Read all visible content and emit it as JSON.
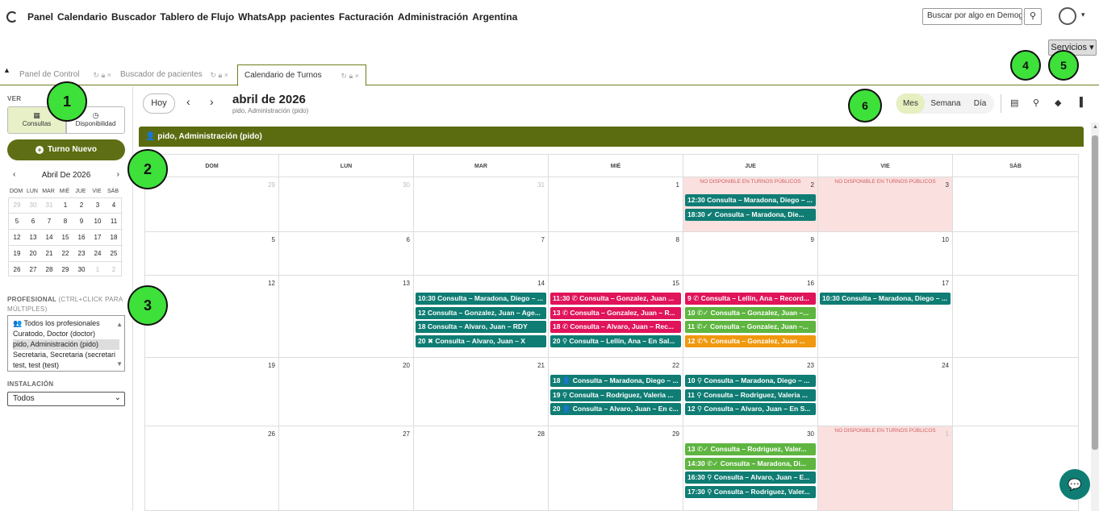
{
  "topnav": {
    "menu": [
      "Panel",
      "Calendario",
      "Buscador",
      "Tablero de Flujo",
      "WhatsApp",
      "pacientes",
      "Facturación",
      "Administración",
      "Argentina"
    ],
    "search_placeholder": "Buscar por algo en Demogra",
    "servicios_label": "Servicios"
  },
  "tabs": [
    {
      "label": "Panel de Control",
      "active": false
    },
    {
      "label": "Buscador de pacientes",
      "active": false
    },
    {
      "label": "Calendario de Turnos",
      "active": true
    }
  ],
  "sidebar": {
    "ver_label": "VER",
    "consultas_label": "Consultas",
    "disponibilidad_label": "Disponibilidad",
    "turno_nuevo_label": "Turno Nuevo",
    "minical": {
      "title": "Abril De 2026",
      "weekdays": [
        "DOM",
        "LUN",
        "MAR",
        "MIÉ",
        "JUE",
        "VIE",
        "SÁB"
      ],
      "weeks": [
        [
          "29",
          "30",
          "31",
          "1",
          "2",
          "3",
          "4"
        ],
        [
          "5",
          "6",
          "7",
          "8",
          "9",
          "10",
          "11"
        ],
        [
          "12",
          "13",
          "14",
          "15",
          "16",
          "17",
          "18"
        ],
        [
          "19",
          "20",
          "21",
          "22",
          "23",
          "24",
          "25"
        ],
        [
          "26",
          "27",
          "28",
          "29",
          "30",
          "1",
          "2"
        ]
      ]
    },
    "profesional_label": "PROFESIONAL",
    "profesional_hint": "(CTRL+CLICK PARA MÚLTIPLES)",
    "profesionales": [
      "Todos los profesionales",
      "Curatodo, Doctor (doctor)",
      "pido, Administración (pido)",
      "Secretaria, Secretaria (secretari",
      "test, test (test)"
    ],
    "profesional_selected": "pido, Administración (pido)",
    "instalacion_label": "INSTALACIÓN",
    "instalacion_value": "Todos"
  },
  "toolbar": {
    "hoy": "Hoy",
    "title": "abril de 2026",
    "subtitle": "pido, Administración (pido)",
    "views": [
      "Mes",
      "Semana",
      "Día"
    ],
    "active_view": "Mes"
  },
  "calendar": {
    "resource_header": "pido, Administración (pido)",
    "day_headers": [
      "DOM",
      "LUN",
      "MAR",
      "MIÉ",
      "JUE",
      "VIE",
      "SÁB"
    ],
    "unavailable_label": "NO DISPONIBLE EN TURNOS PÚBLICOS",
    "weeks": [
      {
        "days": [
          {
            "num": "29",
            "dim": true
          },
          {
            "num": "30",
            "dim": true
          },
          {
            "num": "31",
            "dim": true
          },
          {
            "num": "1"
          },
          {
            "num": "2",
            "unavailable": true,
            "events": [
              {
                "time": "12:30",
                "text": "Consulta – Maradona, Diego – ...",
                "color": "teal"
              },
              {
                "time": "18:30",
                "icon": "check-circle-icon",
                "text": "Consulta – Maradona, Die...",
                "color": "teal"
              }
            ]
          },
          {
            "num": "3",
            "unavailable": true
          },
          {
            "num": ""
          }
        ]
      },
      {
        "days": [
          {
            "num": "5"
          },
          {
            "num": "6"
          },
          {
            "num": "7"
          },
          {
            "num": "8"
          },
          {
            "num": "9"
          },
          {
            "num": "10"
          },
          {
            "num": ""
          }
        ]
      },
      {
        "days": [
          {
            "num": "12"
          },
          {
            "num": "13"
          },
          {
            "num": "14",
            "events": [
              {
                "time": "10:30",
                "text": "Consulta – Maradona, Diego – ...",
                "color": "teal"
              },
              {
                "time": "12",
                "text": "Consulta – Gonzalez, Juan – Age...",
                "color": "teal"
              },
              {
                "time": "18",
                "text": "Consulta – Alvaro, Juan – RDY",
                "color": "teal"
              },
              {
                "time": "20",
                "icon": "x-circle-icon",
                "text": "Consulta – Alvaro, Juan – X",
                "color": "teal"
              }
            ]
          },
          {
            "num": "15",
            "events": [
              {
                "time": "11:30",
                "icon": "whatsapp-icon",
                "text": "Consulta – Gonzalez, Juan ...",
                "color": "pink"
              },
              {
                "time": "13",
                "icon": "whatsapp-icon",
                "text": "Consulta – Gonzalez, Juan – R...",
                "color": "pink"
              },
              {
                "time": "18",
                "icon": "whatsapp-icon",
                "text": "Consulta – Alvaro, Juan – Rec...",
                "color": "pink"
              },
              {
                "time": "20",
                "icon": "location-pin-icon",
                "text": "Consulta – Lellín, Ana – En Sal...",
                "color": "teal"
              }
            ]
          },
          {
            "num": "16",
            "events": [
              {
                "time": "9",
                "icon": "whatsapp-icon",
                "text": "Consulta – Lellín, Ana – Record...",
                "color": "pink"
              },
              {
                "time": "10",
                "icon": "whatsapp-check-icon",
                "text": "Consulta – Gonzalez, Juan –...",
                "color": "green"
              },
              {
                "time": "11",
                "icon": "whatsapp-check-icon",
                "text": "Consulta – Gonzalez, Juan –...",
                "color": "green"
              },
              {
                "time": "12",
                "icon": "whatsapp-edit-icon",
                "text": "Consulta – Gonzalez, Juan ...",
                "color": "orange"
              }
            ]
          },
          {
            "num": "17",
            "events": [
              {
                "time": "10:30",
                "text": "Consulta – Maradona, Diego – ...",
                "color": "teal"
              }
            ]
          },
          {
            "num": ""
          }
        ]
      },
      {
        "days": [
          {
            "num": "19"
          },
          {
            "num": "20"
          },
          {
            "num": "21"
          },
          {
            "num": "22",
            "events": [
              {
                "time": "18",
                "icon": "person-icon",
                "text": "Consulta – Maradona, Diego – ...",
                "color": "teal"
              },
              {
                "time": "19",
                "icon": "location-pin-icon",
                "text": "Consulta – Rodriguez, Valeria ...",
                "color": "teal"
              },
              {
                "time": "20",
                "icon": "person-icon",
                "text": "Consulta – Alvaro, Juan – En c...",
                "color": "teal"
              }
            ]
          },
          {
            "num": "23",
            "events": [
              {
                "time": "10",
                "icon": "location-pin-icon",
                "text": "Consulta – Maradona, Diego – ...",
                "color": "teal"
              },
              {
                "time": "11",
                "icon": "location-pin-icon",
                "text": "Consulta – Rodriguez, Valeria ...",
                "color": "teal"
              },
              {
                "time": "12",
                "icon": "location-pin-icon",
                "text": "Consulta – Alvaro, Juan – En S...",
                "color": "teal"
              }
            ]
          },
          {
            "num": "24"
          },
          {
            "num": ""
          }
        ]
      },
      {
        "days": [
          {
            "num": "26"
          },
          {
            "num": "27"
          },
          {
            "num": "28"
          },
          {
            "num": "29"
          },
          {
            "num": "30",
            "events": [
              {
                "time": "13",
                "icon": "whatsapp-check-icon",
                "text": "Consulta – Rodriguez, Valer...",
                "color": "green"
              },
              {
                "time": "14:30",
                "icon": "whatsapp-check-icon",
                "text": "Consulta – Maradona, Di...",
                "color": "green"
              },
              {
                "time": "16:30",
                "icon": "location-pin-icon",
                "text": "Consulta – Alvaro, Juan – E...",
                "color": "teal"
              },
              {
                "time": "17:30",
                "icon": "location-pin-icon",
                "text": "Consulta – Rodriguez, Valer...",
                "color": "teal"
              }
            ]
          },
          {
            "num": "1",
            "dim": true,
            "unavailable": true
          },
          {
            "num": ""
          }
        ]
      }
    ]
  },
  "annotations": [
    "1",
    "2",
    "3",
    "4",
    "5",
    "6"
  ],
  "colors": {
    "primary": "#5b6b10",
    "teal": "#0f7d74",
    "pink": "#e0145a",
    "green": "#5eb540",
    "orange": "#f0980e",
    "unavailable": "#fbe0e0"
  }
}
